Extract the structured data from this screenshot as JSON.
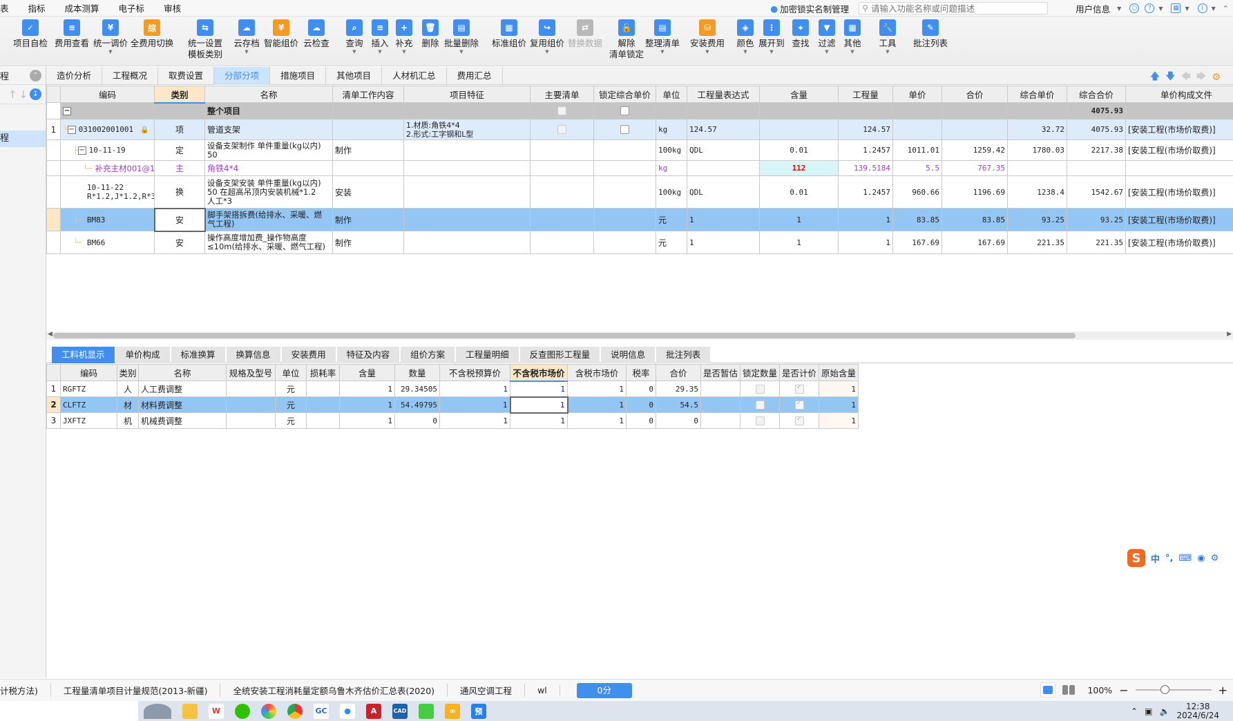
{
  "menu": {
    "items": [
      "指标",
      "成本测算",
      "电子标",
      "审核"
    ],
    "lock_manager": "加密锁实名制管理",
    "search_placeholder": "请输入功能名称或问题描述",
    "user_info": "用户信息"
  },
  "ribbon": {
    "buttons": [
      {
        "label": "项目自检",
        "icon": "self-check-icon",
        "color": "blue"
      },
      {
        "label": "费用查看",
        "icon": "fee-view-icon",
        "color": "blue"
      },
      {
        "label": "统一调价",
        "icon": "unified-price-icon",
        "color": "blue",
        "dropdown": true
      },
      {
        "label": "全费用切换",
        "icon": "full-fee-switch-icon",
        "color": "orange"
      },
      {
        "label": "统一设置",
        "label2": "模板类别",
        "icon": "unified-settings-icon",
        "color": "blue"
      },
      {
        "label": "云存档",
        "icon": "cloud-archive-icon",
        "color": "blue",
        "dropdown": true
      },
      {
        "label": "智能组价",
        "icon": "smart-pricing-icon",
        "color": "orange"
      },
      {
        "label": "云检查",
        "icon": "cloud-check-icon",
        "color": "blue"
      },
      {
        "label": "查询",
        "icon": "query-icon",
        "color": "blue",
        "dropdown": true
      },
      {
        "label": "插入",
        "icon": "insert-icon",
        "color": "blue",
        "dropdown": true
      },
      {
        "label": "补充",
        "icon": "supplement-icon",
        "color": "blue",
        "dropdown": true
      },
      {
        "label": "删除",
        "icon": "delete-icon",
        "color": "blue"
      },
      {
        "label": "批量删除",
        "icon": "batch-delete-icon",
        "color": "blue",
        "dropdown": true
      },
      {
        "label": "标准组价",
        "icon": "standard-pricing-icon",
        "color": "blue"
      },
      {
        "label": "复用组价",
        "icon": "reuse-pricing-icon",
        "color": "blue",
        "dropdown": true
      },
      {
        "label": "替换数据",
        "icon": "replace-data-icon",
        "color": "gray",
        "disabled": true
      },
      {
        "label": "解除",
        "label2": "清单锁定",
        "icon": "unlock-icon",
        "color": "blue"
      },
      {
        "label": "整理清单",
        "icon": "organize-list-icon",
        "color": "blue",
        "dropdown": true
      },
      {
        "label": "安装费用",
        "icon": "install-fee-icon",
        "color": "orange",
        "dropdown": true
      },
      {
        "label": "颜色",
        "icon": "color-icon",
        "color": "blue",
        "dropdown": true
      },
      {
        "label": "展开到",
        "icon": "expand-to-icon",
        "color": "blue",
        "dropdown": true
      },
      {
        "label": "查找",
        "icon": "find-icon",
        "color": "blue"
      },
      {
        "label": "过滤",
        "icon": "filter-icon",
        "color": "blue",
        "dropdown": true
      },
      {
        "label": "其他",
        "icon": "other-icon",
        "color": "blue",
        "dropdown": true
      },
      {
        "label": "工具",
        "icon": "tools-icon",
        "color": "blue",
        "dropdown": true
      },
      {
        "label": "批注列表",
        "icon": "annotation-list-icon",
        "color": "blue"
      }
    ]
  },
  "left_pane": {
    "header": "程",
    "item": "程"
  },
  "main_tabs": [
    "造价分析",
    "工程概况",
    "取费设置",
    "分部分项",
    "措施项目",
    "其他项目",
    "人材机汇总",
    "费用汇总"
  ],
  "main_tabs_active": 3,
  "upper_grid": {
    "columns": [
      "",
      "编码",
      "类别",
      "名称",
      "清单工作内容",
      "项目特征",
      "主要清单",
      "锁定综合单价",
      "单位",
      "工程量表达式",
      "含量",
      "工程量",
      "单价",
      "合价",
      "综合单价",
      "综合合价",
      "单价构成文件"
    ],
    "total_row": {
      "name": "整个项目",
      "total": "4075.93"
    },
    "rows": [
      {
        "no": "1",
        "code": "031002001001",
        "type": "项",
        "name": "管道支架",
        "work": "",
        "feature1": "1.材质:角铁4*4",
        "feature2": "2.形式:工字钢和L型",
        "unit": "kg",
        "expr": "124.57",
        "content": "",
        "qty": "124.57",
        "price": "",
        "amount": "",
        "comp_price": "32.72",
        "comp_amount": "4075.93",
        "file": "[安装工程(市场价取费)]"
      },
      {
        "no": "",
        "code": "10-11-19",
        "type": "定",
        "name1": "设备支架制作 单件重量(kg以内)",
        "name2": "50",
        "work": "制作",
        "unit": "100kg",
        "expr": "QDL",
        "content": "0.01",
        "qty": "1.2457",
        "price": "1011.01",
        "amount": "1259.42",
        "comp_price": "1780.03",
        "comp_amount": "2217.38",
        "file": "[安装工程(市场价取费)]"
      },
      {
        "no": "",
        "code": "补充主材001@1",
        "type": "主",
        "name": "角铁4*4",
        "work": "",
        "unit": "kg",
        "expr": "",
        "content": "112",
        "qty": "139.5184",
        "price": "5.5",
        "amount": "767.35",
        "comp_price": "",
        "comp_amount": "",
        "file": ""
      },
      {
        "no": "",
        "code1": "10-11-22",
        "code2": "R*1.2,J*1.2,R*3",
        "type": "换",
        "name1": "设备支架安装 单件重量(kg以内)",
        "name2": "50  在超高吊顶内安装机械*1.2",
        "name3": "人工*3",
        "work": "安装",
        "unit": "100kg",
        "expr": "QDL",
        "content": "0.01",
        "qty": "1.2457",
        "price": "960.66",
        "amount": "1196.69",
        "comp_price": "1238.4",
        "comp_amount": "1542.67",
        "file": "[安装工程(市场价取费)]"
      },
      {
        "no": "",
        "code": "BM83",
        "type": "安",
        "name1": "脚手架搭拆费(给排水、采暖、燃",
        "name2": "气工程)",
        "work": "制作",
        "unit": "元",
        "expr": "1",
        "content": "1",
        "qty": "1",
        "price": "83.85",
        "amount": "83.85",
        "comp_price": "93.25",
        "comp_amount": "93.25",
        "file": "[安装工程(市场价取费)]"
      },
      {
        "no": "",
        "code": "BM66",
        "type": "安",
        "name1": "操作高度增加费_操作物高度",
        "name2": "≤10m(给排水、采暖、燃气工程)",
        "work": "制作",
        "unit": "元",
        "expr": "1",
        "content": "1",
        "qty": "1",
        "price": "167.69",
        "amount": "167.69",
        "comp_price": "221.35",
        "comp_amount": "221.35",
        "file": "[安装工程(市场价取费)]"
      }
    ]
  },
  "lower_tabs": [
    "工料机显示",
    "单价构成",
    "标准换算",
    "换算信息",
    "安装费用",
    "特征及内容",
    "组价方案",
    "工程量明细",
    "反查图形工程量",
    "说明信息",
    "批注列表"
  ],
  "lower_tabs_active": 0,
  "lower_grid": {
    "columns": [
      "",
      "编码",
      "类别",
      "名称",
      "规格及型号",
      "单位",
      "损耗率",
      "含量",
      "数量",
      "不含税预算价",
      "不含税市场价",
      "含税市场价",
      "税率",
      "合价",
      "是否暂估",
      "锁定数量",
      "是否计价",
      "原始含量"
    ],
    "rows": [
      {
        "no": "1",
        "code": "RGFTZ",
        "type": "人",
        "name": "人工费调整",
        "spec": "",
        "unit": "元",
        "loss": "",
        "content": "1",
        "qty": "29.34505",
        "budget": "1",
        "market": "1",
        "tax_market": "1",
        "tax": "0",
        "amount": "29.35",
        "est": "",
        "lock_qty": false,
        "priced": true,
        "orig": "1"
      },
      {
        "no": "2",
        "code": "CLFTZ",
        "type": "材",
        "name": "材料费调整",
        "spec": "",
        "unit": "元",
        "loss": "",
        "content": "1",
        "qty": "54.49795",
        "budget": "1",
        "market": "1",
        "tax_market": "1",
        "tax": "0",
        "amount": "54.5",
        "est": "",
        "lock_qty": false,
        "priced": true,
        "orig": "1"
      },
      {
        "no": "3",
        "code": "JXFTZ",
        "type": "机",
        "name": "机械费调整",
        "spec": "",
        "unit": "元",
        "loss": "",
        "content": "1",
        "qty": "0",
        "budget": "1",
        "market": "1",
        "tax_market": "1",
        "tax": "0",
        "amount": "0",
        "est": "",
        "lock_qty": false,
        "priced": true,
        "orig": "1"
      }
    ]
  },
  "status_bar": {
    "items": [
      "计税方法)",
      "工程量清单项目计量规范(2013-新疆)",
      "全统安装工程消耗量定额乌鲁木齐估价汇总表(2020)",
      "通风空调工程",
      "wl"
    ],
    "score": "0分",
    "zoom": "100%"
  },
  "ime": {
    "mode": "中",
    "punct": "°,"
  },
  "taskbar": {
    "time": "12:38",
    "date": "2024/6/24"
  }
}
